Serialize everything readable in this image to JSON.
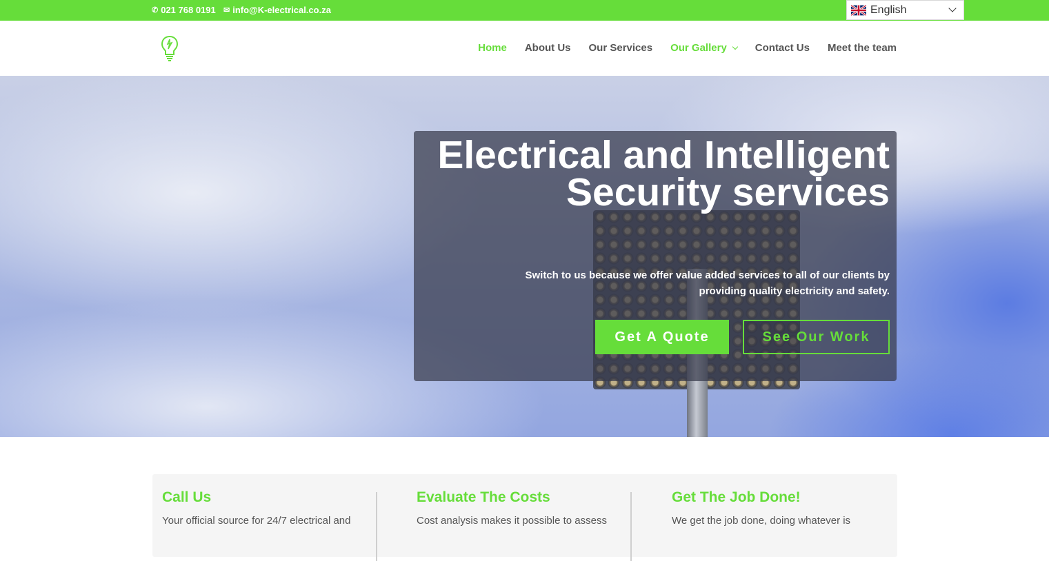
{
  "topbar": {
    "phone": "021 768 0191",
    "email": "info@K-electrical.co.za",
    "phone_icon": "phone-icon",
    "email_icon": "envelope-icon",
    "language": "English",
    "language_flag": "uk-flag-icon"
  },
  "nav": {
    "items": [
      {
        "label": "Home"
      },
      {
        "label": "About Us"
      },
      {
        "label": "Our Services"
      },
      {
        "label": "Our Gallery"
      },
      {
        "label": "Contact Us"
      },
      {
        "label": "Meet the team"
      }
    ]
  },
  "hero": {
    "title": "Electrical and Intelligent Security services",
    "subtitle": "Switch to us because we offer value added services to all of our clients by providing quality electricity and safety.",
    "cta_primary": "Get A Quote",
    "cta_secondary": "See Our Work"
  },
  "features": [
    {
      "title": "Call Us",
      "text": "Your official source for 24/7 electrical and"
    },
    {
      "title": "Evaluate The Costs",
      "text": "Cost analysis makes it possible to assess"
    },
    {
      "title": "Get The Job Done!",
      "text": "We get the job done, doing whatever is"
    }
  ],
  "colors": {
    "accent": "#66dd3a",
    "nav_text": "#555555",
    "overlay": "#373a4b"
  }
}
